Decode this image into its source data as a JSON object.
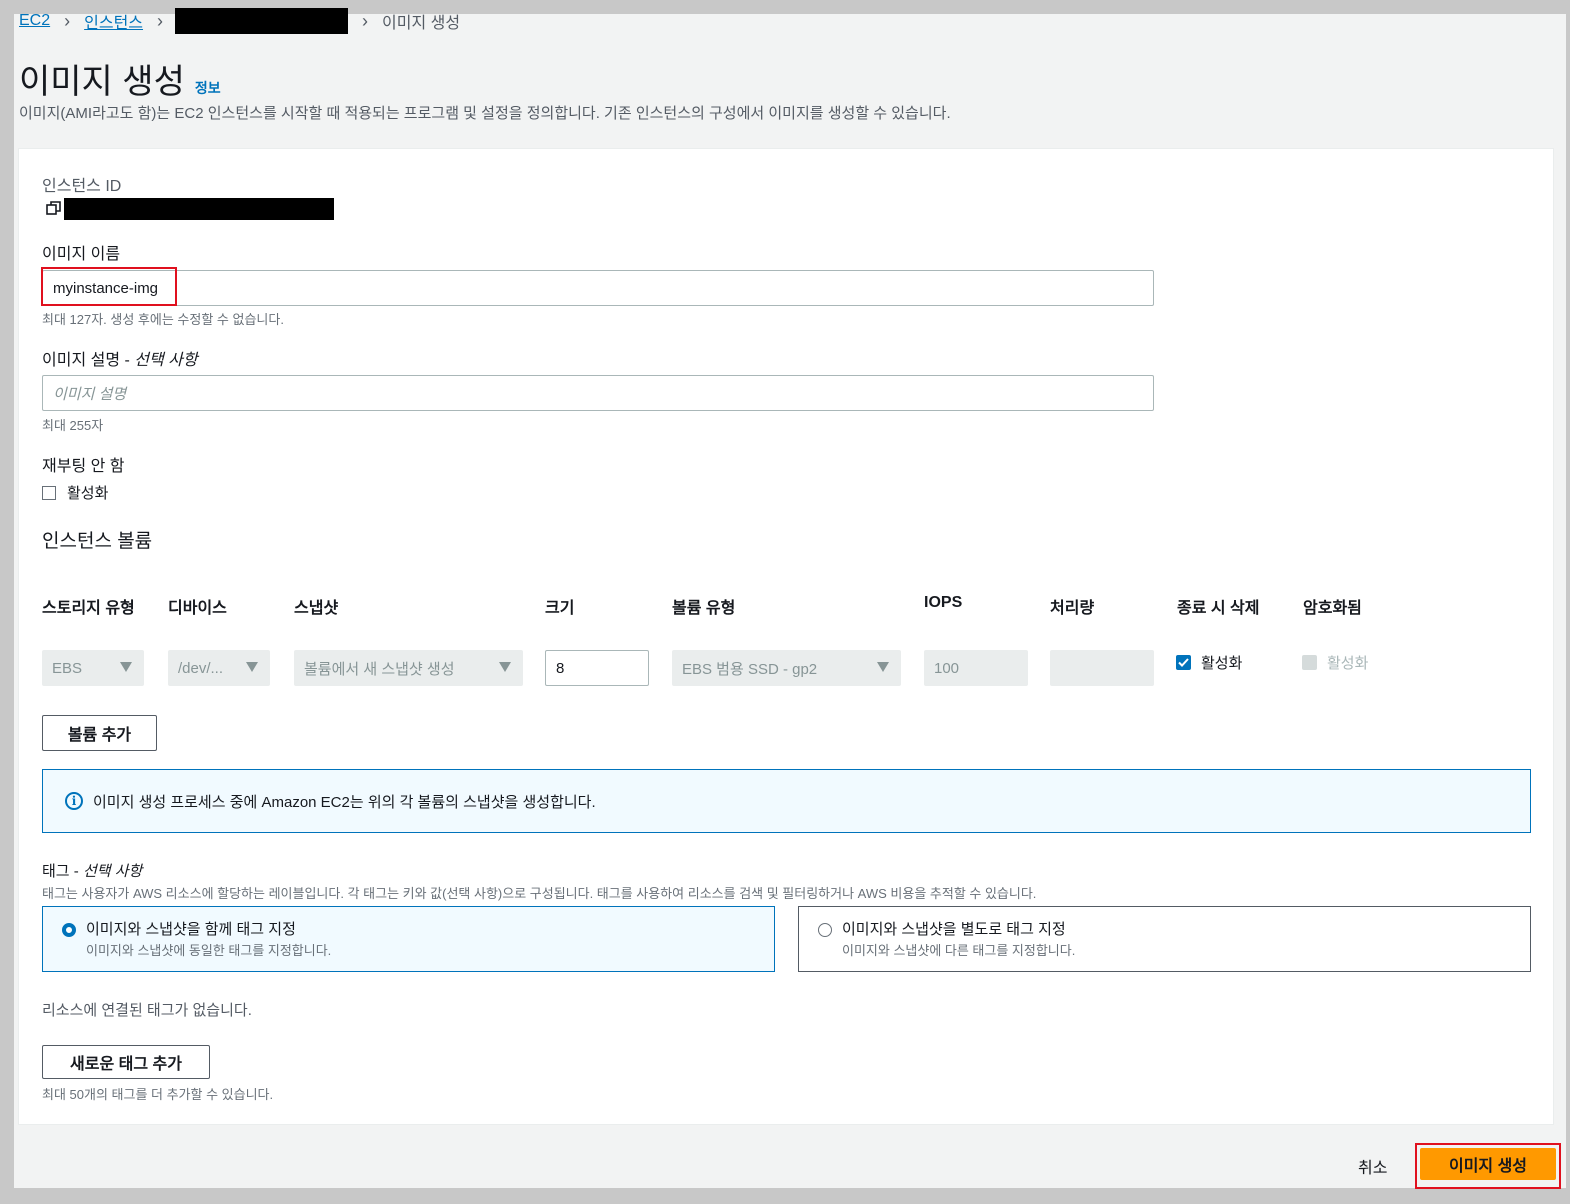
{
  "breadcrumb": {
    "ec2": "EC2",
    "instances": "인스턴스",
    "current": "이미지 생성"
  },
  "header": {
    "title": "이미지 생성",
    "info": "정보",
    "description": "이미지(AMI라고도 함)는 EC2 인스턴스를 시작할 때 적용되는 프로그램 및 설정을 정의합니다. 기존 인스턴스의 구성에서 이미지를 생성할 수 있습니다."
  },
  "form": {
    "instance_id_label": "인스턴스 ID",
    "image_name_label": "이미지 이름",
    "image_name_value": "myinstance-img",
    "image_name_hint": "최대 127자. 생성 후에는 수정할 수 없습니다.",
    "image_desc_label": "이미지 설명 - ",
    "image_desc_optional": "선택 사항",
    "image_desc_placeholder": "이미지 설명",
    "image_desc_hint": "최대 255자",
    "no_reboot_label": "재부팅 안 함",
    "no_reboot_checkbox": "활성화"
  },
  "volumes": {
    "section_title": "인스턴스 볼륨",
    "headers": [
      "스토리지 유형",
      "디바이스",
      "스냅샷",
      "크기",
      "볼륨 유형",
      "IOPS",
      "처리량",
      "종료 시 삭제",
      "암호화됨"
    ],
    "row": {
      "storage_type": "EBS",
      "device": "/dev/...",
      "snapshot": "볼륨에서 새 스냅샷 생성",
      "size": "8",
      "volume_type": "EBS 범용 SSD - gp2",
      "iops": "100",
      "throughput": "",
      "delete_on_termination": "활성화",
      "encrypted": "활성화"
    },
    "add_volume_button": "볼륨 추가"
  },
  "alert": {
    "text": "이미지 생성 프로세스 중에 Amazon EC2는 위의 각 볼륨의 스냅샷을 생성합니다."
  },
  "tags": {
    "label": "태그 - ",
    "optional": "선택 사항",
    "description": "태그는 사용자가 AWS 리소스에 할당하는 레이블입니다. 각 태그는 키와 값(선택 사항)으로 구성됩니다. 태그를 사용하여 리소스를 검색 및 필터링하거나 AWS 비용을 추적할 수 있습니다.",
    "option_together_title": "이미지와 스냅샷을 함께 태그 지정",
    "option_together_desc": "이미지와 스냅샷에 동일한 태그를 지정합니다.",
    "option_separate_title": "이미지와 스냅샷을 별도로 태그 지정",
    "option_separate_desc": "이미지와 스냅샷에 다른 태그를 지정합니다.",
    "no_tags": "리소스에 연결된 태그가 없습니다.",
    "add_tag_button": "새로운 태그 추가",
    "add_tag_hint": "최대 50개의 태그를 더 추가할 수 있습니다."
  },
  "footer": {
    "cancel": "취소",
    "create": "이미지 생성"
  },
  "colors": {
    "primary": "#ff9900",
    "link": "#0073bb",
    "highlight": "#e0101e"
  }
}
